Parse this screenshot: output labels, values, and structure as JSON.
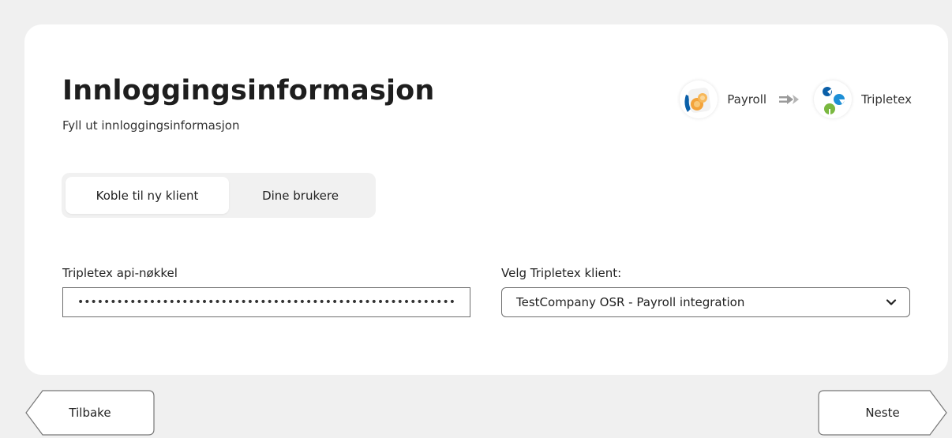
{
  "header": {
    "title": "Innloggingsinformasjon",
    "subtitle": "Fyll ut innloggingsinformasjon"
  },
  "integration": {
    "source_label": "Payroll",
    "target_label": "Tripletex"
  },
  "tabs": [
    {
      "label": "Koble til ny klient",
      "active": true
    },
    {
      "label": "Dine brukere",
      "active": false
    }
  ],
  "form": {
    "api_key_label": "Tripletex api-nøkkel",
    "api_key_value": "••••••••••••••••••••••••••••••••••••••••••••••••••••••••••••••••",
    "client_label": "Velg Tripletex klient:",
    "client_value": "TestCompany OSR - Payroll integration"
  },
  "nav": {
    "back_label": "Tilbake",
    "next_label": "Neste"
  },
  "colors": {
    "page_bg": "#f0f0f0",
    "card_bg": "#ffffff",
    "tripletex_blue": "#0a5fa8",
    "tripletex_lightblue": "#1d8fd6",
    "tripletex_green": "#7ab840",
    "payroll_orange": "#f3a33a"
  }
}
